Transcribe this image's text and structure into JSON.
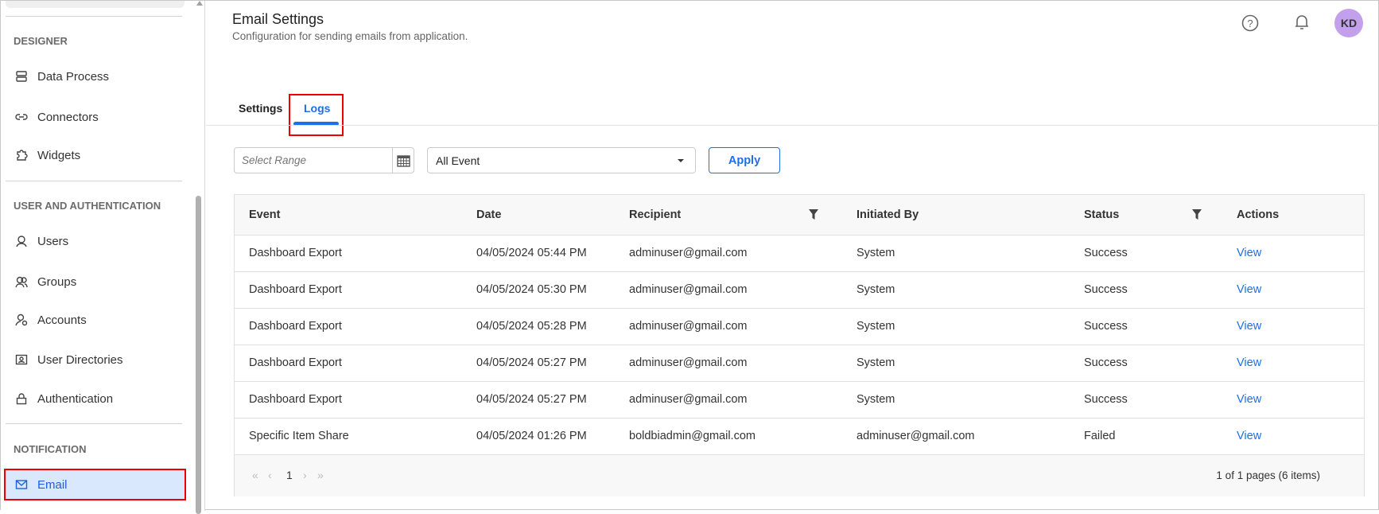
{
  "sidebar": {
    "sections": [
      {
        "label": "DESIGNER",
        "items": [
          {
            "label": "Data Process",
            "icon": "data-process-icon"
          },
          {
            "label": "Connectors",
            "icon": "link-icon"
          },
          {
            "label": "Widgets",
            "icon": "puzzle-icon"
          }
        ]
      },
      {
        "label": "USER AND AUTHENTICATION",
        "items": [
          {
            "label": "Users",
            "icon": "user-icon"
          },
          {
            "label": "Groups",
            "icon": "group-icon"
          },
          {
            "label": "Accounts",
            "icon": "account-icon"
          },
          {
            "label": "User Directories",
            "icon": "directory-icon"
          },
          {
            "label": "Authentication",
            "icon": "lock-icon"
          }
        ]
      },
      {
        "label": "NOTIFICATION",
        "items": [
          {
            "label": "Email",
            "icon": "mail-icon",
            "active": true
          }
        ]
      }
    ]
  },
  "header": {
    "title": "Email Settings",
    "subtitle": "Configuration for sending emails from application.",
    "avatar": "KD",
    "avatar_color": "#c3a0ec"
  },
  "tabs": [
    {
      "label": "Settings"
    },
    {
      "label": "Logs",
      "active": true
    }
  ],
  "filters": {
    "range_placeholder": "Select Range",
    "event_value": "All Event",
    "apply_label": "Apply"
  },
  "table": {
    "columns": [
      "Event",
      "Date",
      "Recipient",
      "Initiated By",
      "Status",
      "Actions"
    ],
    "rows": [
      [
        "Dashboard Export",
        "04/05/2024 05:44 PM",
        "adminuser@gmail.com",
        "System",
        "Success",
        "View"
      ],
      [
        "Dashboard Export",
        "04/05/2024 05:30 PM",
        "adminuser@gmail.com",
        "System",
        "Success",
        "View"
      ],
      [
        "Dashboard Export",
        "04/05/2024 05:28 PM",
        "adminuser@gmail.com",
        "System",
        "Success",
        "View"
      ],
      [
        "Dashboard Export",
        "04/05/2024 05:27 PM",
        "adminuser@gmail.com",
        "System",
        "Success",
        "View"
      ],
      [
        "Dashboard Export",
        "04/05/2024 05:27 PM",
        "adminuser@gmail.com",
        "System",
        "Success",
        "View"
      ],
      [
        "Specific Item Share",
        "04/05/2024 01:26 PM",
        "boldbiadmin@gmail.com",
        "adminuser@gmail.com",
        "Failed",
        "View"
      ]
    ]
  },
  "pager": {
    "current": "1",
    "summary": "1 of 1 pages (6 items)"
  }
}
